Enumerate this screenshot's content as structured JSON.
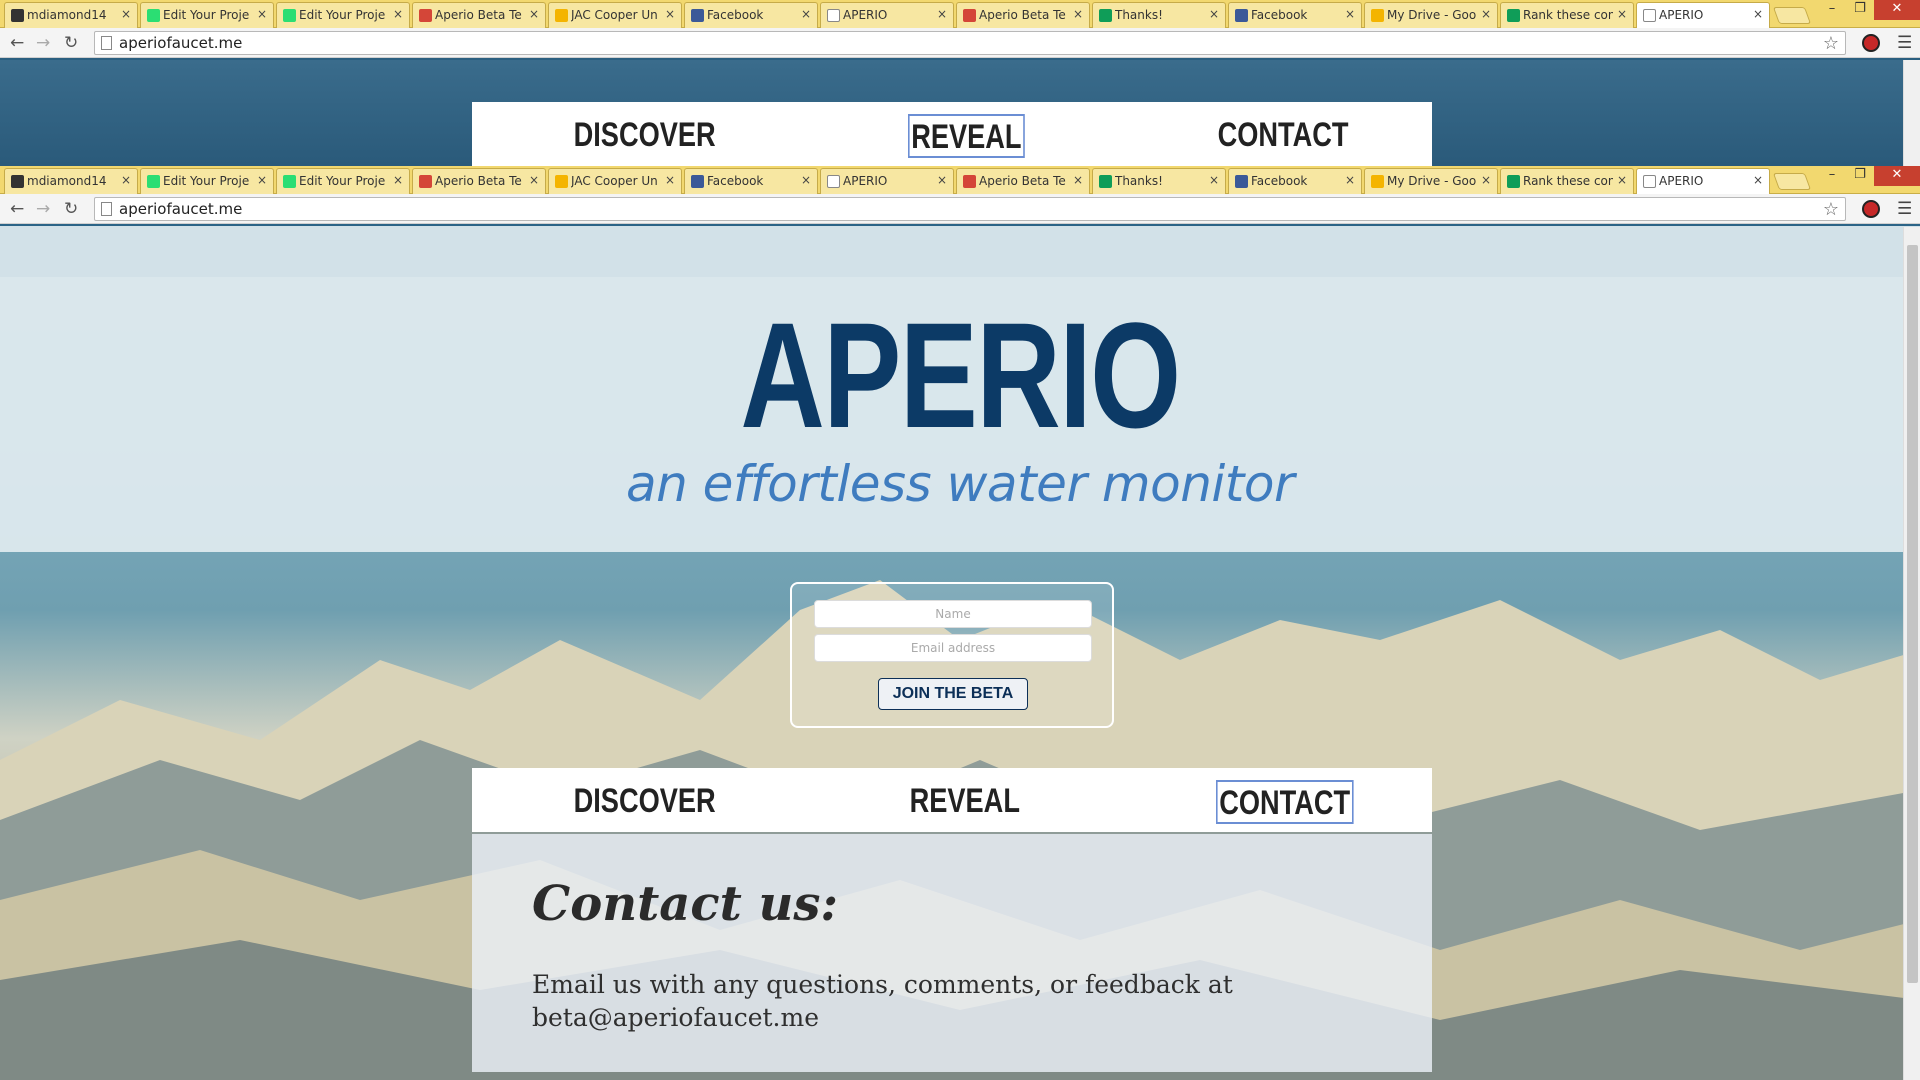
{
  "browser": {
    "url": "aperiofaucet.me",
    "tabs": [
      {
        "label": "mdiamond14",
        "icon": "github-icon",
        "color": "#333333"
      },
      {
        "label": "Edit Your Proje",
        "icon": "kickstarter-icon",
        "color": "#2bde73"
      },
      {
        "label": "Edit Your Proje",
        "icon": "kickstarter-icon",
        "color": "#2bde73"
      },
      {
        "label": "Aperio Beta Te",
        "icon": "gmail-icon",
        "color": "#d44638"
      },
      {
        "label": "JAC Cooper Un",
        "icon": "drive-icon",
        "color": "#f4b400"
      },
      {
        "label": "Facebook",
        "icon": "facebook-icon",
        "color": "#3b5998"
      },
      {
        "label": "APERIO",
        "icon": "page-icon",
        "color": "#ffffff"
      },
      {
        "label": "Aperio Beta Te",
        "icon": "gmail-icon",
        "color": "#d44638"
      },
      {
        "label": "Thanks!",
        "icon": "forms-icon",
        "color": "#0f9d58"
      },
      {
        "label": "Facebook",
        "icon": "facebook-icon",
        "color": "#3b5998"
      },
      {
        "label": "My Drive - Goo",
        "icon": "drive-icon",
        "color": "#f4b400"
      },
      {
        "label": "Rank these con",
        "icon": "sheets-icon",
        "color": "#0f9d58"
      },
      {
        "label": "APERIO",
        "icon": "page-icon",
        "color": "#ffffff",
        "active": true
      }
    ]
  },
  "nav": [
    "DISCOVER",
    "REVEAL",
    "CONTACT"
  ],
  "hero": {
    "title": "APERIO",
    "tagline": "an effortless water monitor"
  },
  "signup": {
    "name_placeholder": "Name",
    "email_placeholder": "Email address",
    "button_label": "JOIN THE BETA"
  },
  "contact": {
    "heading": "Contact us:",
    "line1": "Email us with any questions, comments, or feedback at",
    "email": "beta@aperiofaucet.me"
  },
  "colors": {
    "title": "#0c3a66",
    "tagline": "#3f7cbf",
    "active_nav_outline": "#6b8ed4"
  }
}
